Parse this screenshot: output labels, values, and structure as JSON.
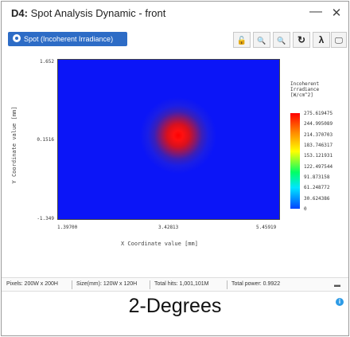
{
  "window": {
    "title_prefix": "D4:",
    "title": " Spot Analysis Dynamic - front",
    "minimize_glyph": "—",
    "close_glyph": "✕"
  },
  "toolbar": {
    "spot_button_label": "Spot (Incoherent Irradiance)",
    "tools": [
      {
        "name": "lock-icon",
        "glyph": "🔓"
      },
      {
        "name": "zoom-in-icon",
        "glyph": "🔍"
      },
      {
        "name": "zoom-out-icon",
        "glyph": "🔍"
      },
      {
        "name": "refresh-icon",
        "glyph": "↻"
      },
      {
        "name": "lambda-icon",
        "glyph": "λ"
      },
      {
        "name": "monitor-icon",
        "glyph": "🖵"
      }
    ]
  },
  "chart_data": {
    "type": "heatmap",
    "ylabel": "Y Coordinate value [mm]",
    "xlabel": "X Coordinate value [mm]",
    "y_ticks": [
      "1.652",
      "0.1516",
      "-1.349"
    ],
    "x_ticks": [
      "1.39700",
      "3.42813",
      "5.45919"
    ],
    "colorbar_title": [
      "Incoherent",
      "Irradiance",
      "[W/cm^2]"
    ],
    "colorbar_ticks": [
      "275.619475",
      "244.995089",
      "214.370703",
      "183.746317",
      "153.121931",
      "122.497544",
      "91.873158",
      "61.248772",
      "30.624386",
      "0"
    ],
    "peak": {
      "x": 3.42813,
      "y": 0.1516,
      "value": 275.619475
    }
  },
  "status": {
    "pixels": "Pixels: 200W x 200H",
    "size": "Size(mm): 120W x 120H",
    "hits": "Total hits: 1,001,101M",
    "power": "Total power: 0.9922"
  },
  "caption": "2-Degrees",
  "info_glyph": "i"
}
